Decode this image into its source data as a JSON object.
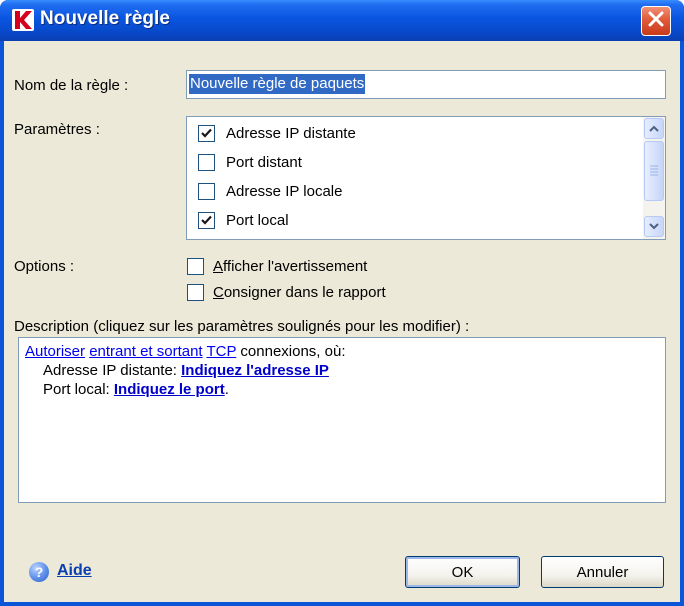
{
  "window": {
    "title": "Nouvelle règle"
  },
  "form": {
    "rule_name_label": "Nom de la règle :",
    "rule_name_value": "Nouvelle règle de paquets",
    "parameters_label": "Paramètres :",
    "parameters": [
      {
        "label": "Adresse IP distante",
        "checked": true
      },
      {
        "label": "Port distant",
        "checked": false
      },
      {
        "label": "Adresse IP locale",
        "checked": false
      },
      {
        "label": "Port local",
        "checked": true
      }
    ],
    "options_label": "Options :",
    "options": [
      {
        "label": "Afficher l'avertissement",
        "accel": "A",
        "rest": "fficher l'avertissement",
        "checked": false
      },
      {
        "label": "Consigner dans le rapport",
        "accel": "C",
        "rest": "onsigner dans le rapport",
        "checked": false
      }
    ]
  },
  "description": {
    "label": "Description (cliquez sur les paramètres soulignés pour les modifier) :",
    "line1": {
      "action": "Autoriser",
      "direction": "entrant et sortant",
      "protocol": "TCP",
      "suffix": "connexions, où:"
    },
    "line2": {
      "label": "Adresse IP distante:",
      "link": "Indiquez l'adresse IP"
    },
    "line3": {
      "label": "Port local:",
      "link": "Indiquez le port",
      "suffix": "."
    }
  },
  "footer": {
    "help_label": "Aide",
    "ok_label": "OK",
    "cancel_label": "Annuler"
  },
  "colors": {
    "titlebar": "#0a55e0",
    "close": "#e05a3a",
    "dialog_bg": "#ece9d8",
    "selection": "#316ac5",
    "link": "#0000ee"
  },
  "icons": {
    "app": "kaspersky-k-icon",
    "close": "close-icon",
    "help": "help-icon"
  }
}
